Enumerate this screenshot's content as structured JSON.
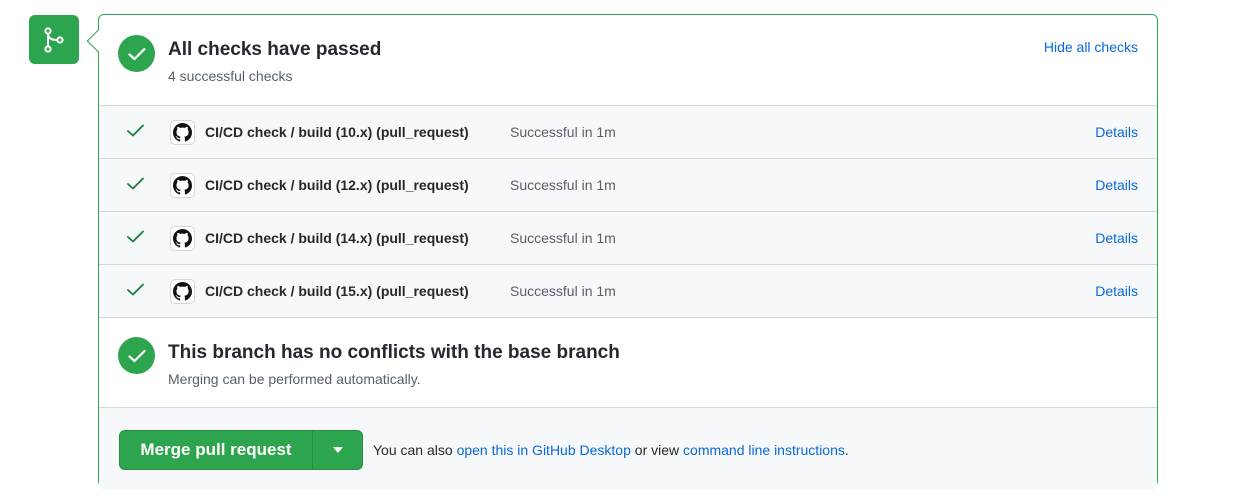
{
  "header": {
    "title": "All checks have passed",
    "subtitle": "4 successful checks",
    "toggle_label": "Hide all checks"
  },
  "checks": [
    {
      "name": "CI/CD check / build (10.x) (pull_request)",
      "status": "Successful in 1m",
      "link": "Details"
    },
    {
      "name": "CI/CD check / build (12.x) (pull_request)",
      "status": "Successful in 1m",
      "link": "Details"
    },
    {
      "name": "CI/CD check / build (14.x) (pull_request)",
      "status": "Successful in 1m",
      "link": "Details"
    },
    {
      "name": "CI/CD check / build (15.x) (pull_request)",
      "status": "Successful in 1m",
      "link": "Details"
    }
  ],
  "branch": {
    "title": "This branch has no conflicts with the base branch",
    "subtitle": "Merging can be performed automatically."
  },
  "merge": {
    "button_label": "Merge pull request",
    "note_prefix": "You can also",
    "desktop_link": "open this in GitHub Desktop",
    "note_middle": "or view",
    "cli_link": "command line instructions",
    "note_suffix": "."
  },
  "icons": {
    "side": "git-branch-icon",
    "check": "check-icon",
    "avatar": "github-mark-icon",
    "dropdown": "triangle-down-icon"
  },
  "colors": {
    "success": "#2da44e",
    "link": "#0969da",
    "muted": "#57606a",
    "border": "#d0d7de"
  }
}
